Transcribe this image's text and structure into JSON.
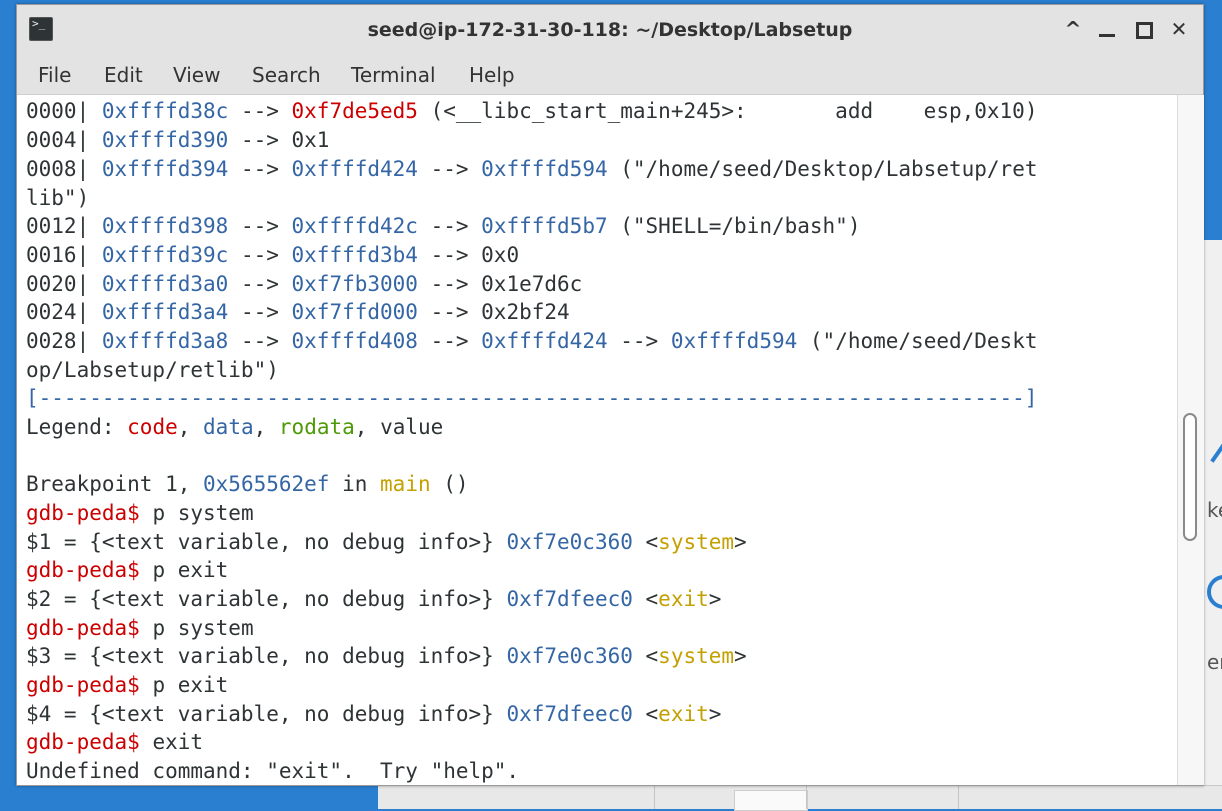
{
  "desktop": {
    "fragments": [
      "ke",
      "er"
    ]
  },
  "window": {
    "title": "seed@ip-172-31-30-118: ~/Desktop/Labsetup",
    "app_icon_glyph": ">_",
    "buttons": {
      "up": "^",
      "close": "✕"
    }
  },
  "menu": {
    "file": "File",
    "edit": "Edit",
    "view": "View",
    "search": "Search",
    "terminal": "Terminal",
    "help": "Help"
  },
  "stack": {
    "l0": {
      "off": "0000| ",
      "a1": "0xffffd38c",
      "arr1": " --> ",
      "a2": "0xf7de5ed5",
      "rest": " (<__libc_start_main+245>:       add    esp,0x10)"
    },
    "l1": {
      "off": "0004| ",
      "a1": "0xffffd390",
      "rest": " --> 0x1"
    },
    "l2": {
      "off": "0008| ",
      "a1": "0xffffd394",
      "arr1": " --> ",
      "a2": "0xffffd424",
      "arr2": " --> ",
      "a3": "0xffffd594",
      "rest": " (\"/home/seed/Desktop/Labsetup/ret"
    },
    "l2b": "lib\")",
    "l3": {
      "off": "0012| ",
      "a1": "0xffffd398",
      "arr1": " --> ",
      "a2": "0xffffd42c",
      "arr2": " --> ",
      "a3": "0xffffd5b7",
      "rest": " (\"SHELL=/bin/bash\")"
    },
    "l4": {
      "off": "0016| ",
      "a1": "0xffffd39c",
      "arr1": " --> ",
      "a2": "0xffffd3b4",
      "rest": " --> 0x0"
    },
    "l5": {
      "off": "0020| ",
      "a1": "0xffffd3a0",
      "arr1": " --> ",
      "a2": "0xf7fb3000",
      "rest": " --> 0x1e7d6c"
    },
    "l6": {
      "off": "0024| ",
      "a1": "0xffffd3a4",
      "arr1": " --> ",
      "a2": "0xf7ffd000",
      "rest": " --> 0x2bf24"
    },
    "l7": {
      "off": "0028| ",
      "a1": "0xffffd3a8",
      "arr1": " --> ",
      "a2": "0xffffd408",
      "arr2": " --> ",
      "a3": "0xffffd424",
      "arr3": " --> ",
      "a4": "0xffffd594",
      "rest": " (\"/home/seed/Deskt"
    },
    "l7b": "op/Labsetup/retlib\")"
  },
  "separator": "[------------------------------------------------------------------------------]",
  "legend": {
    "label": "Legend: ",
    "code": "code",
    "c1": ", ",
    "data": "data",
    "c2": ", ",
    "rodata": "rodata",
    "c3": ", ",
    "value": "value"
  },
  "breakpoint": {
    "prefix": "Breakpoint 1, ",
    "addr": "0x565562ef",
    "in": " in ",
    "func": "main",
    "suffix": " ()"
  },
  "session": {
    "prompt": "gdb-peda$",
    "cmd1": " p system",
    "r1_pre": "$1 = {<text variable, no debug info>} ",
    "r1_addr": "0xf7e0c360",
    "r1_open": " <",
    "r1_sym": "system",
    "r1_close": ">",
    "cmd2": " p exit",
    "r2_pre": "$2 = {<text variable, no debug info>} ",
    "r2_addr": "0xf7dfeec0",
    "r2_open": " <",
    "r2_sym": "exit",
    "r2_close": ">",
    "cmd3": " p system",
    "r3_pre": "$3 = {<text variable, no debug info>} ",
    "r3_addr": "0xf7e0c360",
    "r3_open": " <",
    "r3_sym": "system",
    "r3_close": ">",
    "cmd4": " p exit",
    "r4_pre": "$4 = {<text variable, no debug info>} ",
    "r4_addr": "0xf7dfeec0",
    "r4_open": " <",
    "r4_sym": "exit",
    "r4_close": ">",
    "cmd5": " exit",
    "error": "Undefined command: \"exit\".  Try \"help\"."
  },
  "colors": {
    "address": "#3465a4",
    "code": "#cc0000",
    "rodata": "#4e9a06",
    "symbol": "#c4a000",
    "prompt": "#cc0000"
  }
}
